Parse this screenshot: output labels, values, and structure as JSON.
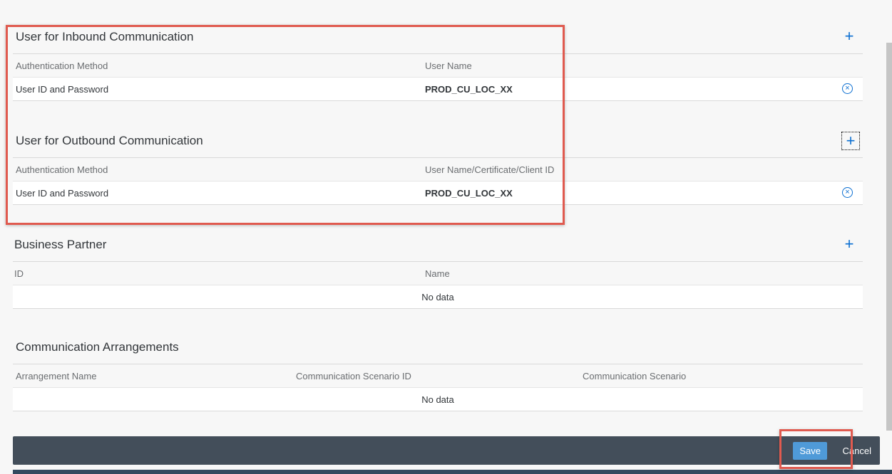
{
  "inbound": {
    "title": "User for Inbound Communication",
    "add_icon": "plus-icon",
    "columns": [
      "Authentication Method",
      "User Name"
    ],
    "rows": [
      {
        "method": "User ID and Password",
        "user": "PROD_CU_LOC_XX",
        "delete_icon": "circle-x-icon"
      }
    ]
  },
  "outbound": {
    "title": "User for Outbound Communication",
    "add_icon": "plus-icon",
    "columns": [
      "Authentication Method",
      "User Name/Certificate/Client ID"
    ],
    "rows": [
      {
        "method": "User ID and Password",
        "user": "PROD_CU_LOC_XX",
        "delete_icon": "circle-x-icon"
      }
    ]
  },
  "business_partner": {
    "title": "Business Partner",
    "add_icon": "plus-icon",
    "columns": [
      "ID",
      "Name"
    ],
    "empty_text": "No data"
  },
  "arrangements": {
    "title": "Communication Arrangements",
    "columns": [
      "Arrangement Name",
      "Communication Scenario ID",
      "Communication Scenario"
    ],
    "empty_text": "No data"
  },
  "footer": {
    "save_label": "Save",
    "cancel_label": "Cancel"
  },
  "colors": {
    "accent": "#0a6ed1",
    "highlight": "#e05a4f",
    "footer_bg": "#434e5a",
    "save_bg": "#4f9ad8"
  }
}
